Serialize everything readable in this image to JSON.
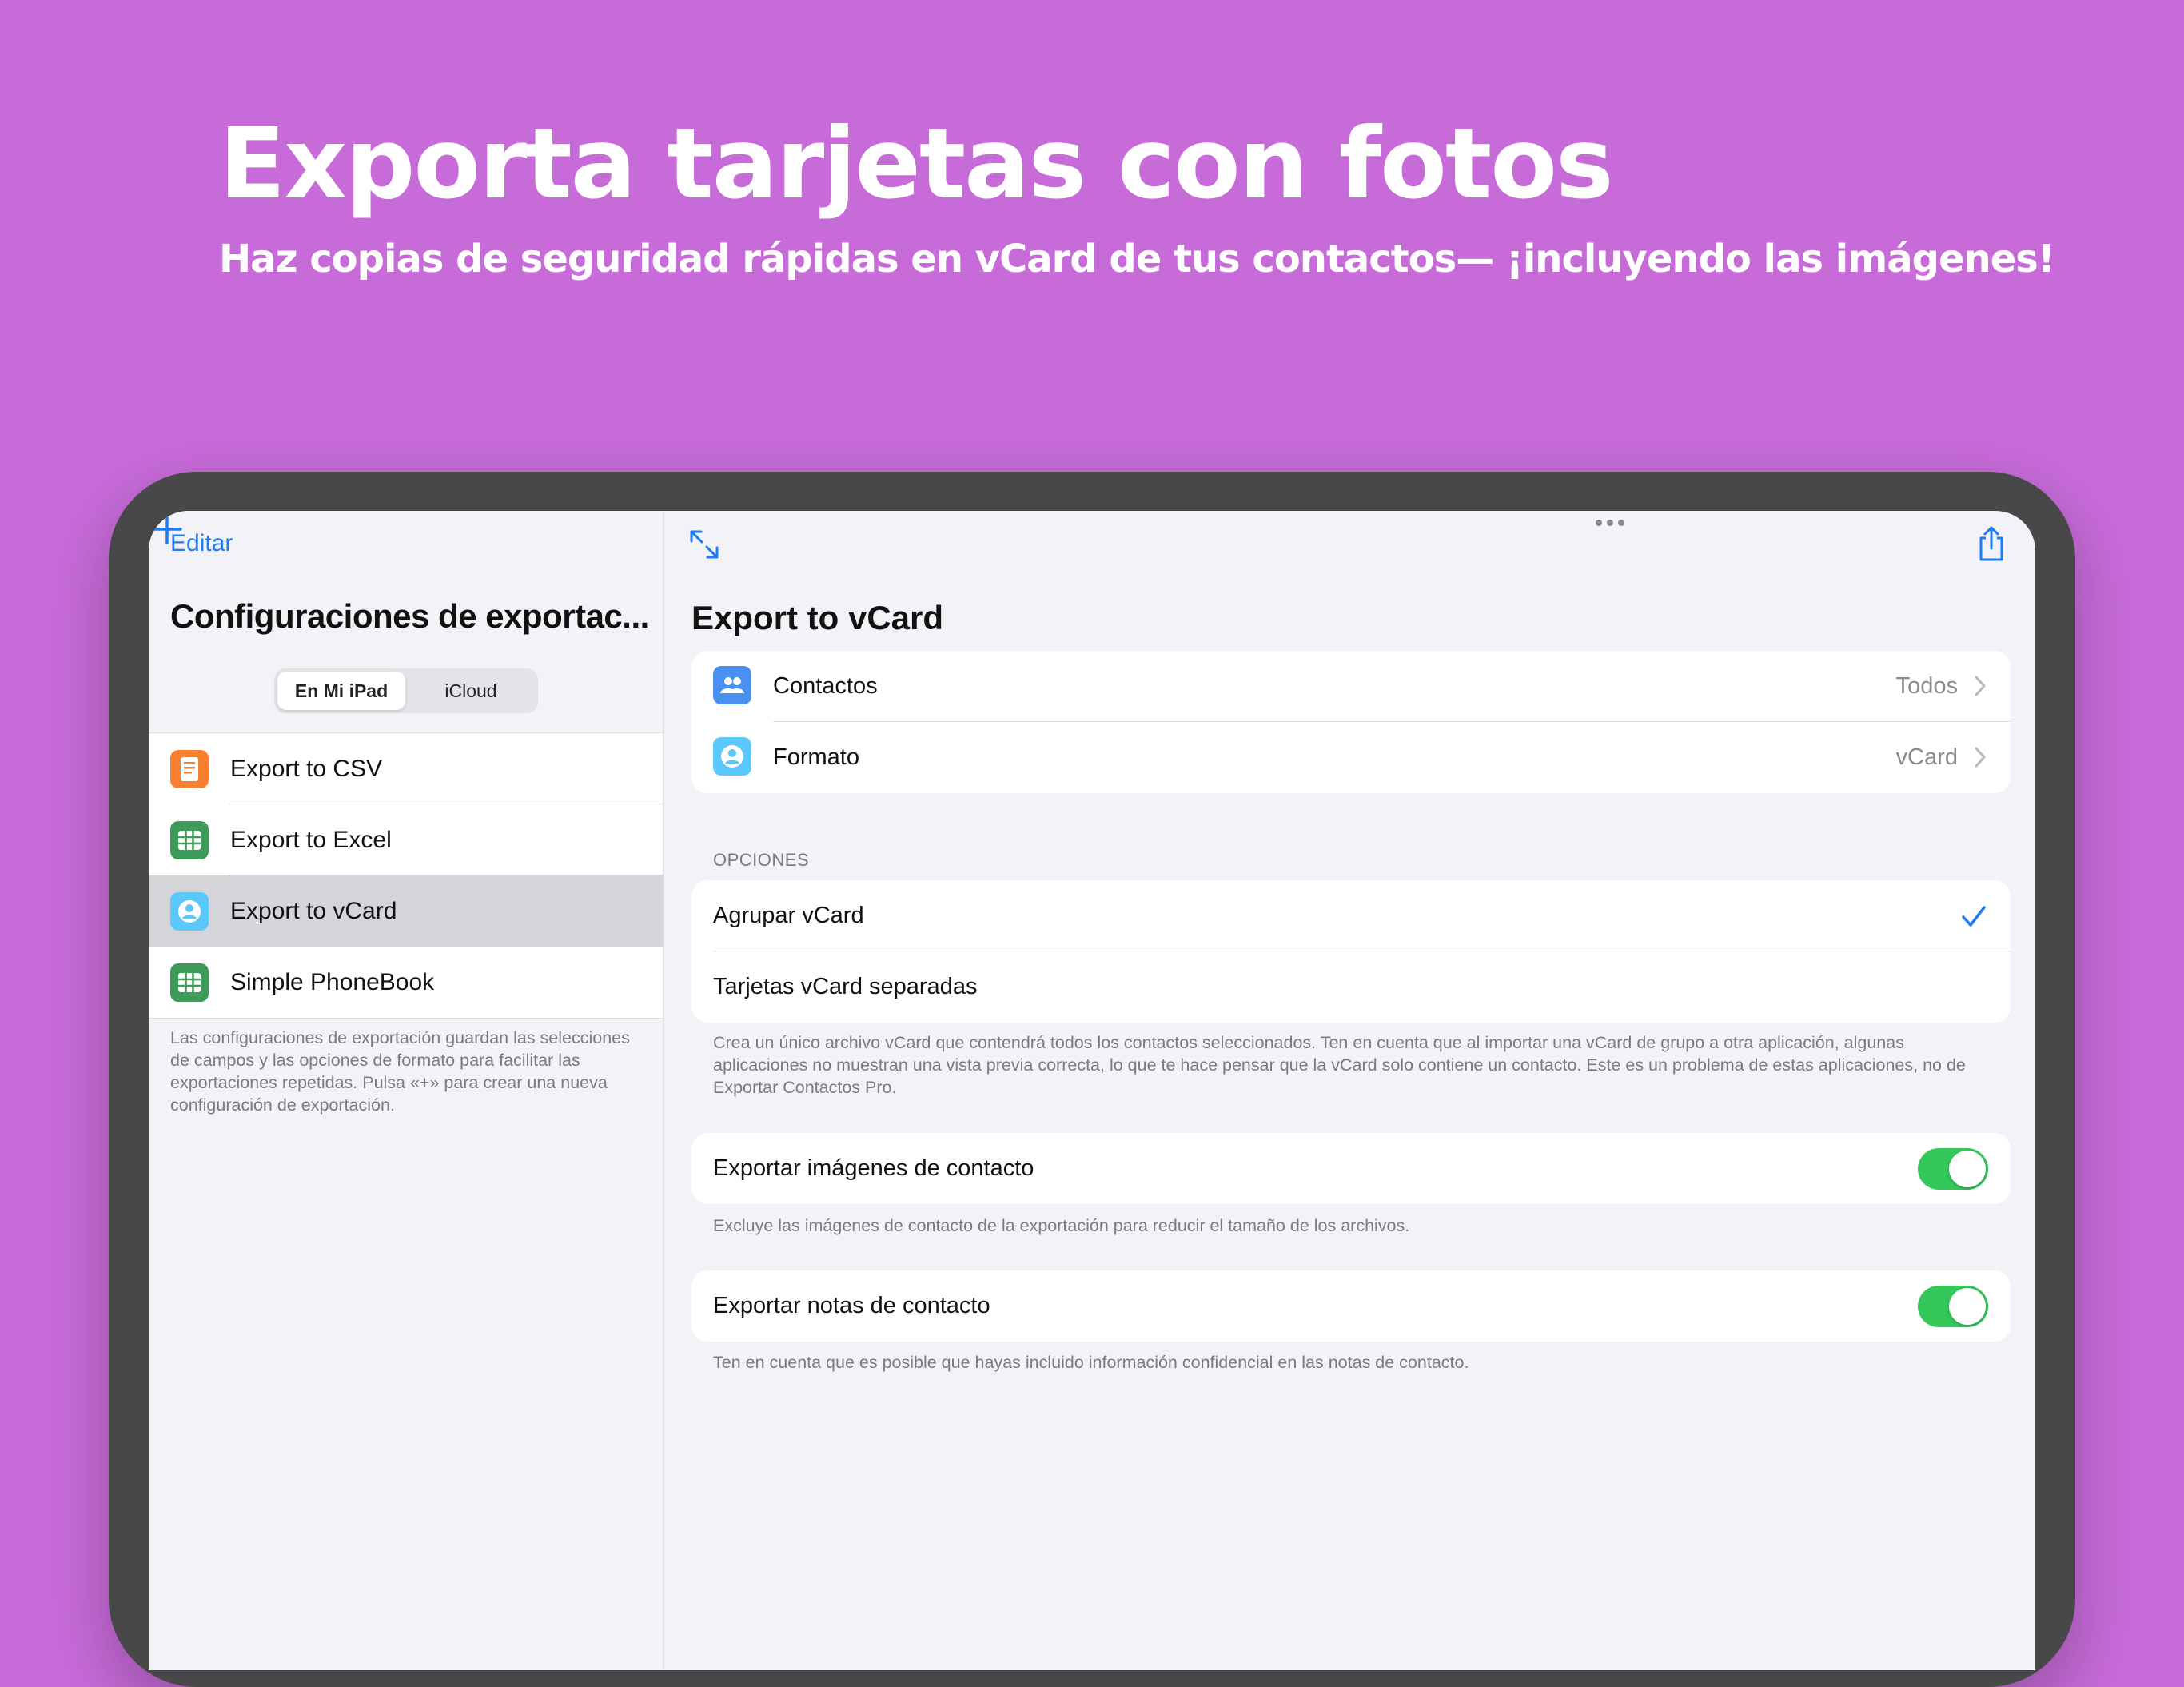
{
  "colors": {
    "background": "#c76bd9",
    "accent": "#1e7cf2",
    "toggle_on": "#34c759",
    "icon_csv": "#f7812f",
    "icon_excel": "#3d9a58",
    "icon_vcard": "#5ac8fa",
    "icon_contacts": "#4a90f0"
  },
  "headline": "Exporta tarjetas con fotos",
  "subheadline": "Haz copias de seguridad rápidas en vCard de tus contactos— ¡incluyendo las imágenes!",
  "sidebar": {
    "edit_label": "Editar",
    "title": "Configuraciones de exportac...",
    "segments": [
      "En Mi iPad",
      "iCloud"
    ],
    "selected_segment": "En Mi iPad",
    "items": [
      {
        "label": "Export to CSV",
        "icon": "document-icon"
      },
      {
        "label": "Export to Excel",
        "icon": "spreadsheet-icon"
      },
      {
        "label": "Export to vCard",
        "icon": "contact-card-icon",
        "selected": true
      },
      {
        "label": "Simple PhoneBook",
        "icon": "spreadsheet-icon"
      }
    ],
    "footer": "Las configuraciones de exportación guardan las selecciones de campos y las opciones de formato para facilitar las exportaciones repetidas. Pulsa «+» para crear una nueva configuración de exportación."
  },
  "detail": {
    "title": "Export to vCard",
    "rows": [
      {
        "label": "Contactos",
        "value": "Todos",
        "icon": "contacts-icon"
      },
      {
        "label": "Formato",
        "value": "vCard",
        "icon": "contact-card-icon"
      }
    ],
    "options_header": "OPCIONES",
    "options": [
      {
        "label": "Agrupar vCard",
        "checked": true
      },
      {
        "label": "Tarjetas vCard separadas",
        "checked": false
      }
    ],
    "options_footer": "Crea un único archivo vCard que contendrá todos los contactos seleccionados. Ten en cuenta que al importar una vCard de grupo a otra aplicación, algunas aplicaciones no muestran una vista previa correcta, lo que te hace pensar que la vCard solo contiene un contacto. Este es un problema de estas aplicaciones, no de Exportar Contactos Pro.",
    "toggles": [
      {
        "label": "Exportar imágenes de contacto",
        "on": true,
        "footer": "Excluye las imágenes de contacto de la exportación para reducir el tamaño de los archivos."
      },
      {
        "label": "Exportar notas de contacto",
        "on": true,
        "footer": "Ten en cuenta que es posible que hayas incluido información confidencial en las notas de contacto."
      }
    ]
  }
}
